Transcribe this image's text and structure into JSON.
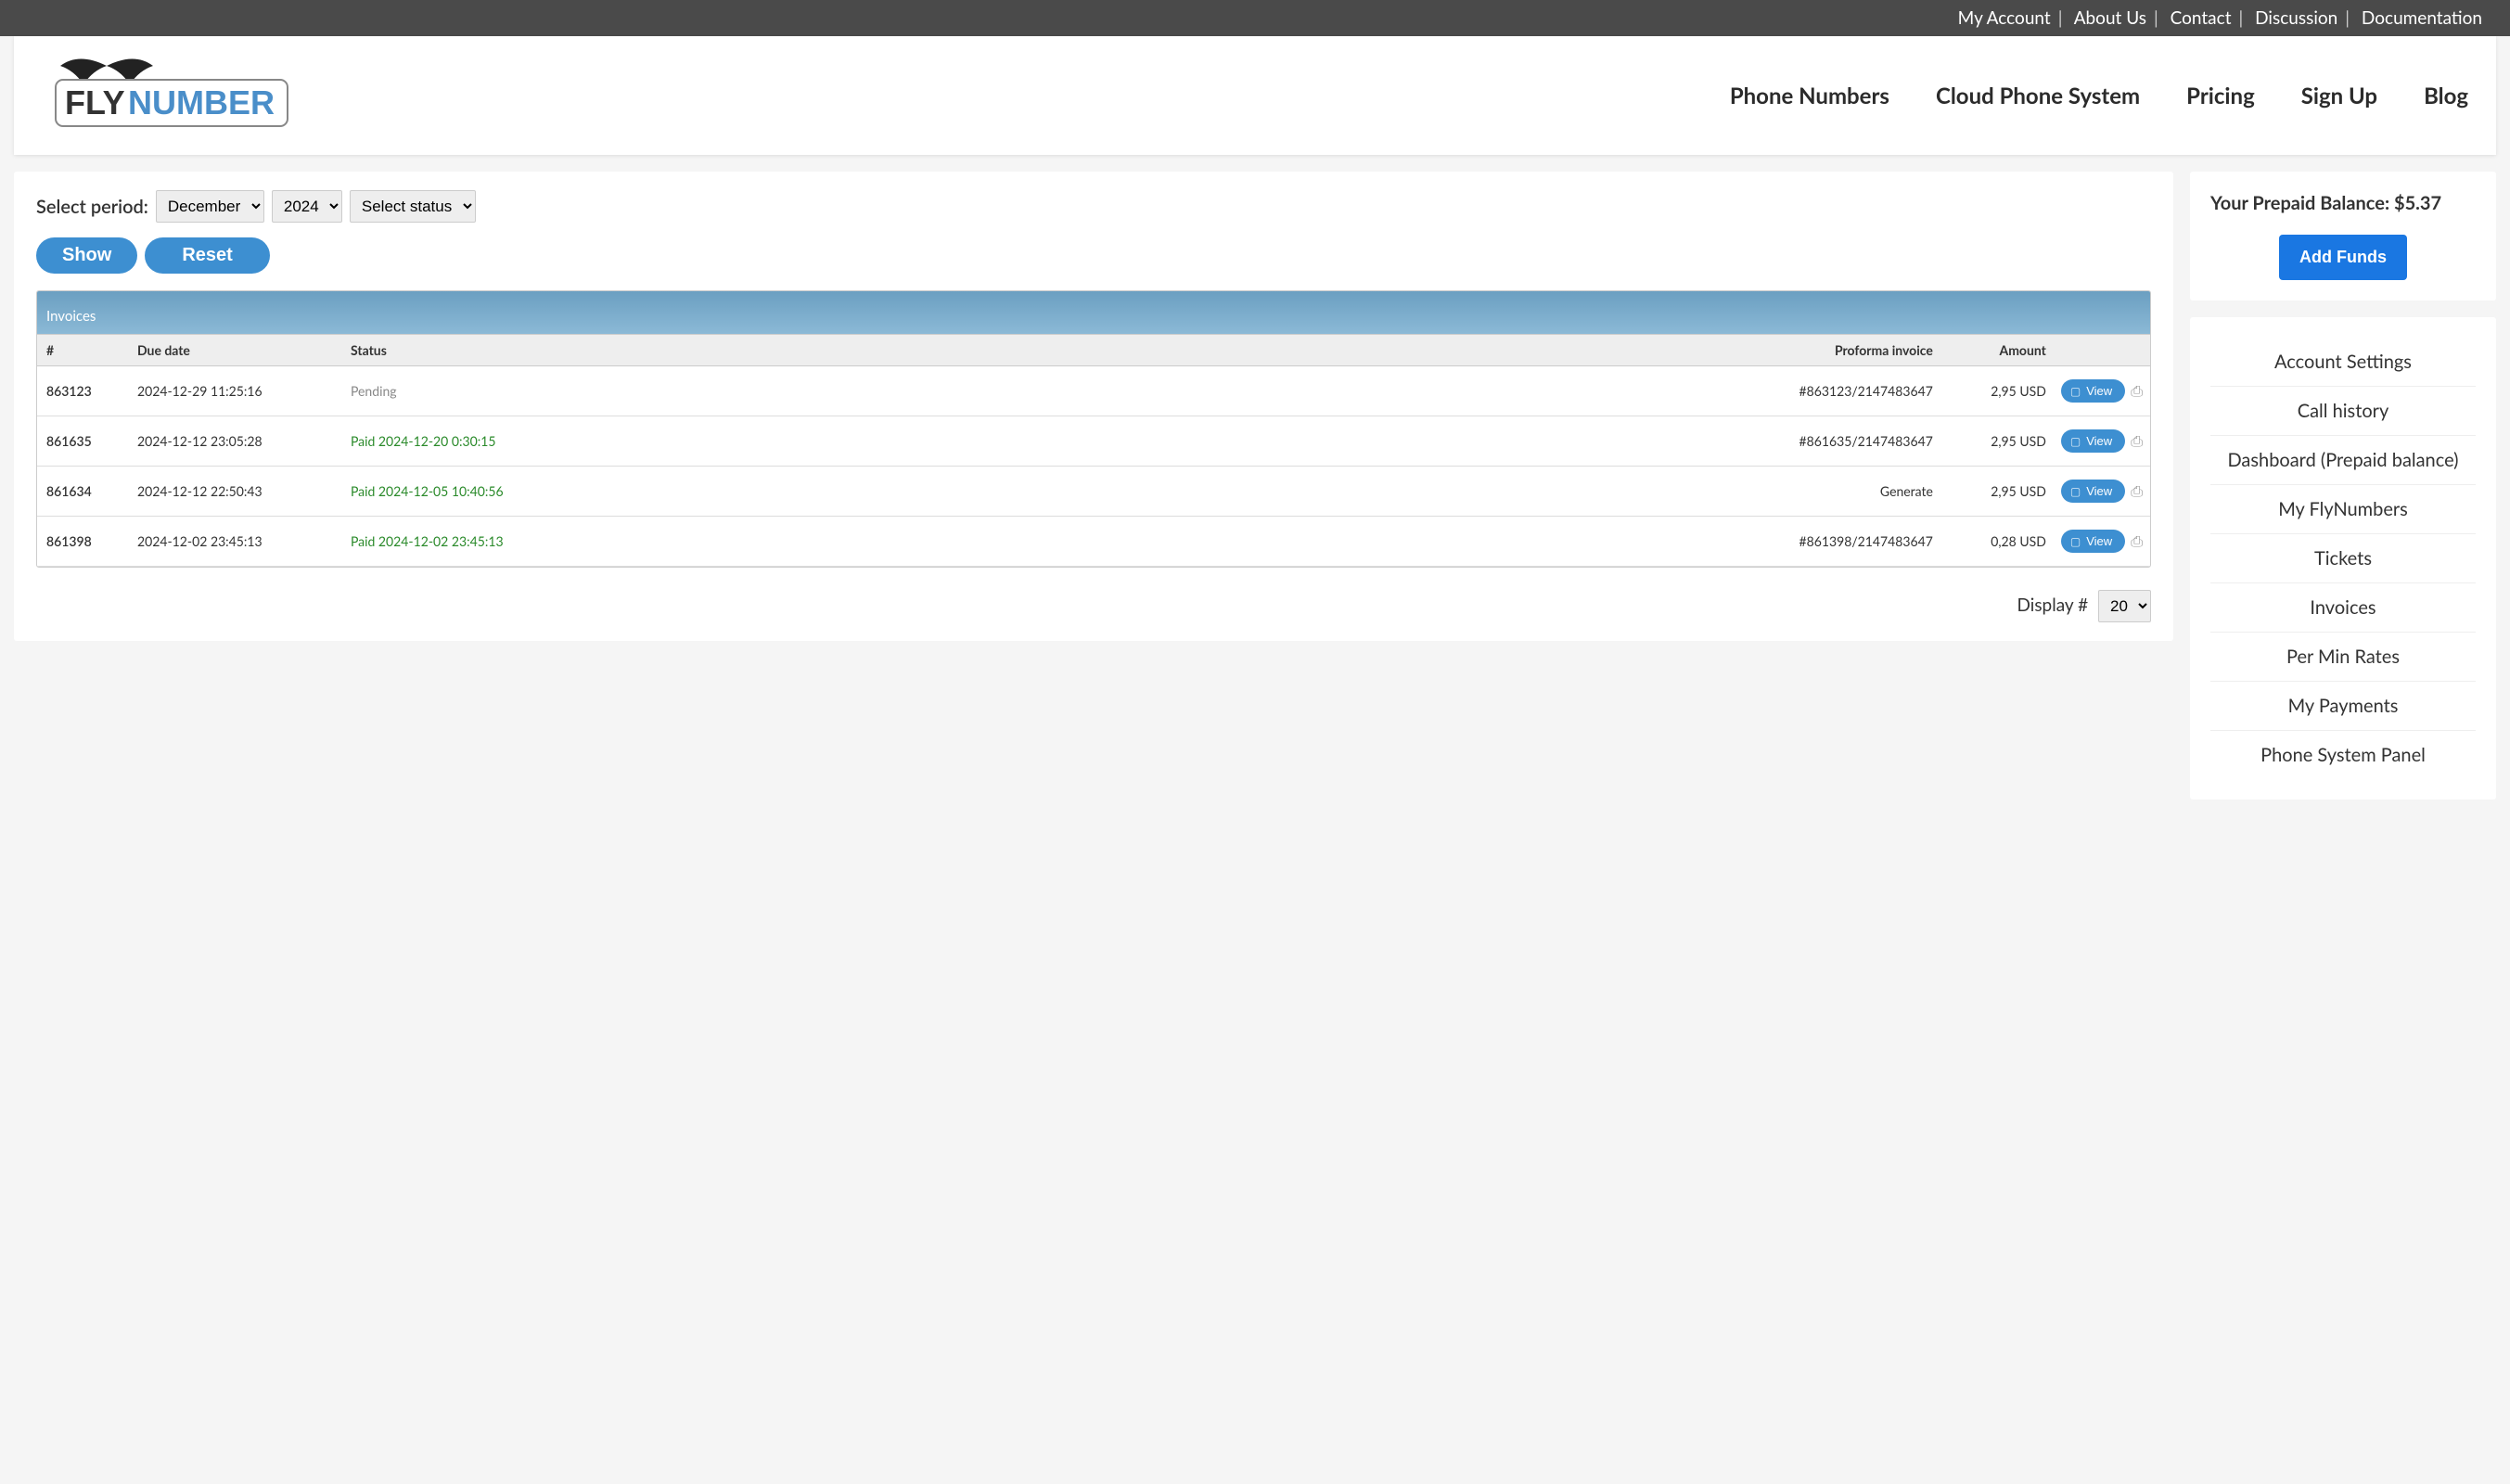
{
  "topnav": [
    "My Account",
    "About Us",
    "Contact",
    "Discussion",
    "Documentation"
  ],
  "logo": {
    "text1": "FLY",
    "text2": "NUMBER"
  },
  "mainnav": [
    "Phone Numbers",
    "Cloud Phone System",
    "Pricing",
    "Sign Up",
    "Blog"
  ],
  "filters": {
    "label": "Select period:",
    "month": "December",
    "year": "2024",
    "status": "Select status",
    "show": "Show",
    "reset": "Reset"
  },
  "table": {
    "title": "Invoices",
    "headers": [
      "#",
      "Due date",
      "Status",
      "Proforma invoice",
      "Amount",
      ""
    ],
    "rows": [
      {
        "id": "863123",
        "due": "2024-12-29 11:25:16",
        "status": "Pending",
        "status_class": "pending",
        "pf": "#863123/2147483647",
        "amount": "2,95 USD"
      },
      {
        "id": "861635",
        "due": "2024-12-12 23:05:28",
        "status": "Paid 2024-12-20 0:30:15",
        "status_class": "paid",
        "pf": "#861635/2147483647",
        "amount": "2,95 USD"
      },
      {
        "id": "861634",
        "due": "2024-12-12 22:50:43",
        "status": "Paid 2024-12-05 10:40:56",
        "status_class": "paid",
        "pf": "Generate",
        "amount": "2,95 USD"
      },
      {
        "id": "861398",
        "due": "2024-12-02 23:45:13",
        "status": "Paid 2024-12-02 23:45:13",
        "status_class": "paid",
        "pf": "#861398/2147483647",
        "amount": "0,28 USD"
      }
    ],
    "view_label": "View",
    "display_label": "Display #",
    "display_value": "20"
  },
  "sidebar": {
    "balance_label": "Your Prepaid Balance:",
    "balance_value": "$5.37",
    "add_funds": "Add Funds",
    "links": [
      "Account Settings",
      "Call history",
      "Dashboard (Prepaid balance)",
      "My FlyNumbers",
      "Tickets",
      "Invoices",
      "Per Min Rates",
      "My Payments",
      "Phone System Panel"
    ]
  }
}
